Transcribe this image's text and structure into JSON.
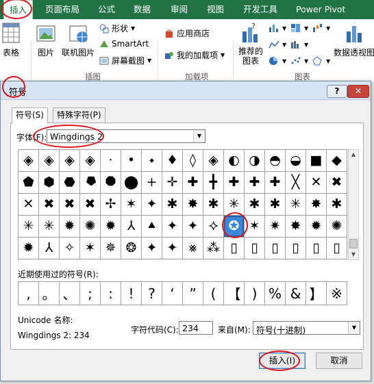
{
  "ribbon_tabs": {
    "insert": "插入",
    "layout": "页面布局",
    "formula": "公式",
    "data": "数据",
    "review": "审阅",
    "view": "视图",
    "developer": "开发工具",
    "powerpivot": "Power Pivot"
  },
  "ribbon": {
    "table": "表格",
    "picture": "图片",
    "online_picture": "联机图片",
    "shapes": "形状",
    "smartart": "SmartArt",
    "screenshot": "屏幕截图",
    "store": "应用商店",
    "my_addins": "我的加载项",
    "recommended_charts_line1": "推荐的",
    "recommended_charts_line2": "图表",
    "pivot_chart": "数据透视图",
    "group_illustrations": "插图",
    "group_addins": "加载项",
    "group_charts": "图表"
  },
  "dialog": {
    "title": "符号",
    "help": "?",
    "close": "✕",
    "tab_symbols": "符号(S)",
    "tab_special": "特殊字符(P)",
    "font_label": "字体(F):",
    "font_value": "Wingdings 2",
    "recent_label": "近期使用过的符号(R):",
    "unicode_name_label": "Unicode 名称:",
    "unicode_name_value": "Wingdings 2: 234",
    "char_code_label": "字符代码(C):",
    "char_code_value": "234",
    "from_label": "来自(M):",
    "from_value": "符号(十进制)",
    "insert_button": "插入(I)",
    "cancel_button": "取消"
  },
  "symbols": [
    [
      "◈",
      "◈",
      "◈",
      "◈",
      "·",
      "•",
      "⬩",
      "♦",
      "◊",
      "◈",
      "◐",
      "◑",
      "◓",
      "◒",
      "■",
      "◆"
    ],
    [
      "⬟",
      "⬢",
      "⬣",
      "⯂",
      "⯃",
      "⬤",
      "+",
      "✛",
      "✚",
      "╋",
      "✚",
      "✚",
      "✚",
      "╳",
      "✕",
      "✖"
    ],
    [
      "✕",
      "✖",
      "✖",
      "✖",
      "✢",
      "✶",
      "✦",
      "✱",
      "✸",
      "✱",
      "✳",
      "✱",
      "✱",
      "✳",
      "✸",
      "✱"
    ],
    [
      "✳",
      "✳",
      "✹",
      "✺",
      "✹",
      "⅄",
      "⯅",
      "✦",
      "✦",
      "⯎",
      "★",
      "✶",
      "✷",
      "✸",
      "✹",
      "✺"
    ],
    [
      "✹",
      "⅄",
      "✧",
      "✶",
      "✵",
      "❂",
      "✦",
      "✦",
      "⨳",
      "⁂",
      "▯",
      "▯",
      "▯",
      "▯",
      "▯",
      "▯"
    ]
  ],
  "selected_symbol": "✪",
  "recent_symbols": [
    ",",
    "。",
    "、",
    ";",
    ":",
    "!",
    "?",
    "‘",
    "”",
    "(",
    "【",
    ")",
    "%",
    "&",
    "】",
    "※"
  ]
}
